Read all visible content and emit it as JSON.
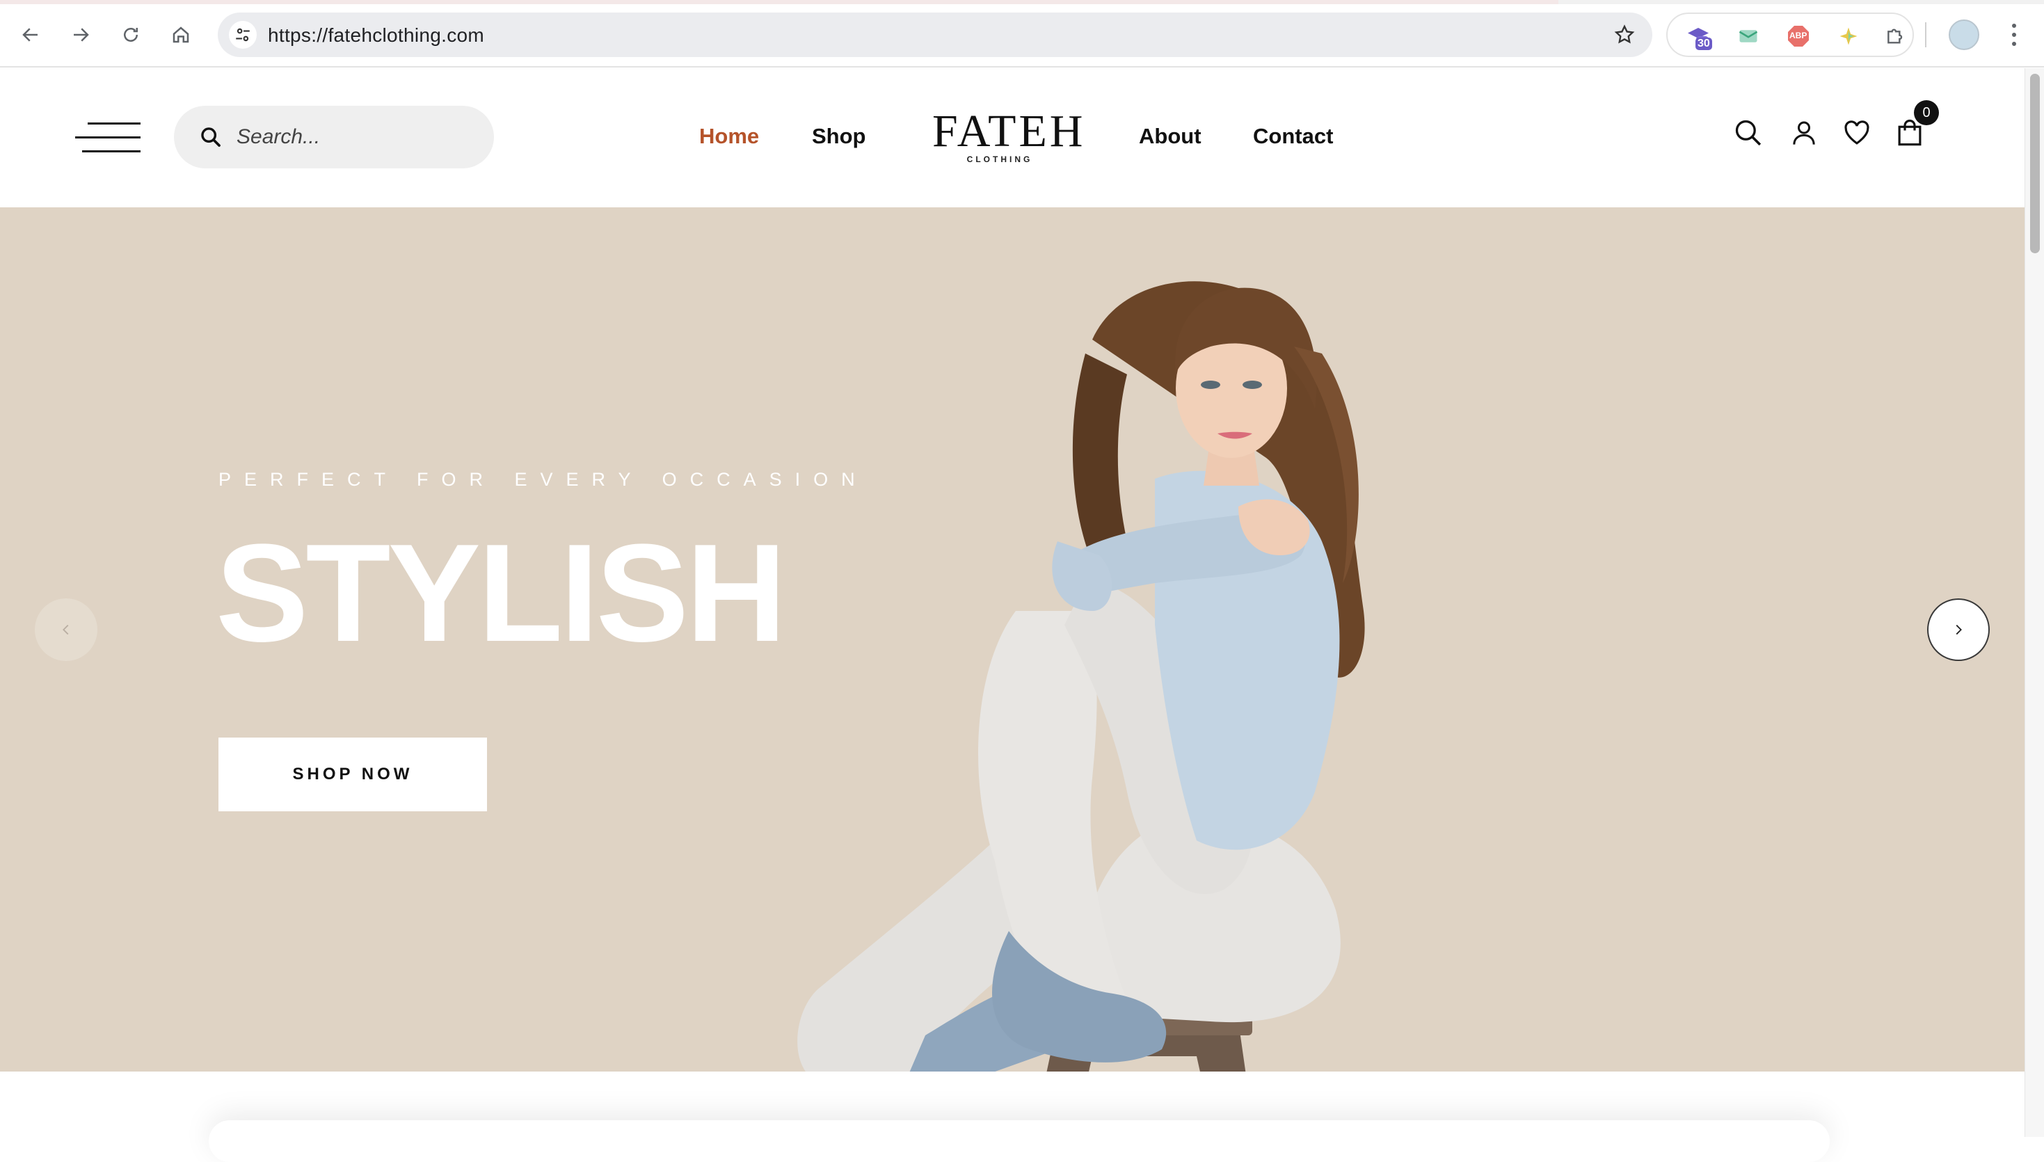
{
  "browser": {
    "url": "https://fatehclothing.com",
    "extension_badge": "30",
    "extension_abp_label": "ABP"
  },
  "header": {
    "search_placeholder": "Search...",
    "nav": [
      {
        "label": "Home",
        "active": true
      },
      {
        "label": "Shop",
        "active": false
      },
      {
        "label": "About",
        "active": false
      },
      {
        "label": "Contact",
        "active": false
      }
    ],
    "logo": {
      "word": "FATEH",
      "sub": "CLOTHING"
    },
    "cart_count": "0",
    "accent_color": "#b5532a"
  },
  "hero": {
    "eyebrow": "PERFECT FOR EVERY OCCASION",
    "headline": "STYLISH",
    "cta_label": "SHOP NOW",
    "background_color": "#dfd3c4",
    "prev_icon": "chevron-left-icon",
    "next_icon": "chevron-right-icon"
  }
}
